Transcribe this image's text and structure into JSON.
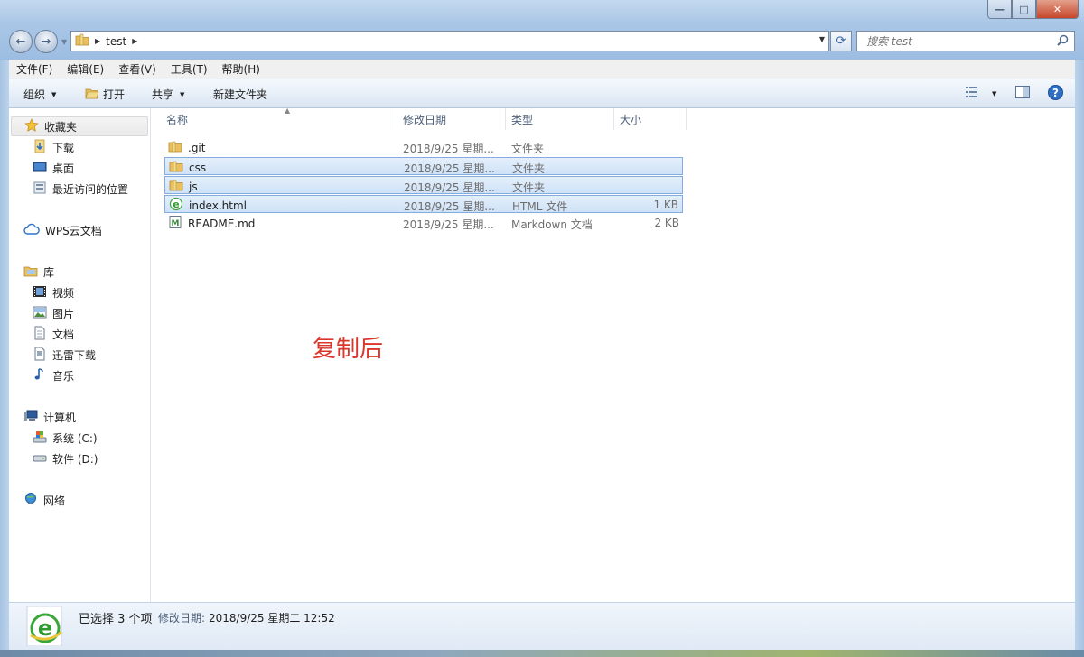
{
  "window": {
    "caption_buttons": {
      "minimize": "—",
      "maximize": "□",
      "close": "✕"
    }
  },
  "address": {
    "breadcrumb": "test",
    "search_placeholder": "搜索 test"
  },
  "menu": [
    "文件(F)",
    "编辑(E)",
    "查看(V)",
    "工具(T)",
    "帮助(H)"
  ],
  "toolbar": {
    "organize": "组织",
    "open": "打开",
    "share": "共享",
    "new_folder": "新建文件夹"
  },
  "nav": {
    "favorites": "收藏夹",
    "downloads": "下载",
    "desktop": "桌面",
    "recent": "最近访问的位置",
    "wps": "WPS云文档",
    "libraries": "库",
    "videos": "视频",
    "pictures": "图片",
    "documents": "文档",
    "xunlei": "迅雷下载",
    "music": "音乐",
    "computer": "计算机",
    "drive_c": "系统 (C:)",
    "drive_d": "软件 (D:)",
    "network": "网络"
  },
  "columns": {
    "name": "名称",
    "date": "修改日期",
    "type": "类型",
    "size": "大小"
  },
  "files": [
    {
      "name": ".git",
      "date": "2018/9/25 星期...",
      "type": "文件夹",
      "size": "",
      "icon": "folder-icon",
      "selected": false
    },
    {
      "name": "css",
      "date": "2018/9/25 星期...",
      "type": "文件夹",
      "size": "",
      "icon": "folder-icon",
      "selected": true
    },
    {
      "name": "js",
      "date": "2018/9/25 星期...",
      "type": "文件夹",
      "size": "",
      "icon": "folder-icon",
      "selected": true
    },
    {
      "name": "index.html",
      "date": "2018/9/25 星期...",
      "type": "HTML 文件",
      "size": "1 KB",
      "icon": "html-file-icon",
      "selected": true
    },
    {
      "name": "README.md",
      "date": "2018/9/25 星期...",
      "type": "Markdown 文档",
      "size": "2 KB",
      "icon": "markdown-file-icon",
      "selected": false
    }
  ],
  "annotation": "复制后",
  "details": {
    "selection": "已选择 3 个项",
    "modified_label": "修改日期:",
    "modified_value": "2018/9/25 星期二 12:52"
  },
  "colors": {
    "selection_bg": "#cfe2f7",
    "selection_border": "#84acdd",
    "annotation": "#d9372c",
    "folder": "#e8c060"
  }
}
